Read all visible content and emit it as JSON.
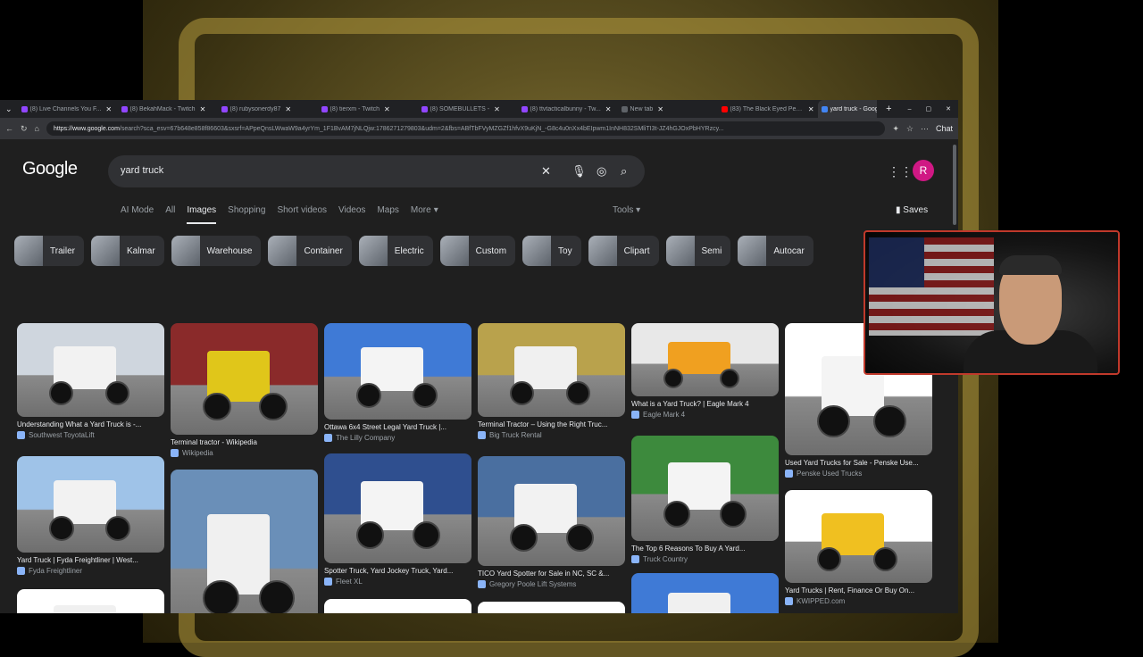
{
  "browser": {
    "tabs": [
      {
        "title": "(8) Live Channels You F...",
        "color": "#9146ff"
      },
      {
        "title": "(8) BekahMack - Twitch",
        "color": "#9146ff"
      },
      {
        "title": "(8) rubysonerdy87",
        "color": "#9146ff"
      },
      {
        "title": "(8) tierxm - Twitch",
        "color": "#9146ff"
      },
      {
        "title": "(8) SOMEBULLETS -",
        "color": "#9146ff"
      },
      {
        "title": "(8) ttvtacticalbunny - Tw...",
        "color": "#9146ff"
      },
      {
        "title": "New tab",
        "color": "#5f6368"
      },
      {
        "title": "(83) The Black Eyed Pea...",
        "color": "#ff0000"
      },
      {
        "title": "yard truck - Google Sea...",
        "color": "#4285f4"
      }
    ],
    "url_domain": "https://www.google.com",
    "url_path": "/search?sca_esv=67b648e858f86603&sxsrf=APpeQnsLWwaW9a4yrYm_1F1BvAM7jNLQjw:1786271279803&udm=2&fbs=ABfTbFVyMZGZf1hfvX9uKjN_-G8c4u0nXx4bEIpwm1InNH832SMliTI3t-JZ4hGJOxPbHYRzcy...",
    "chat_label": "Chat"
  },
  "google": {
    "logo": "Google",
    "query": "yard truck",
    "avatar_letter": "R",
    "nav": [
      "AI Mode",
      "All",
      "Images",
      "Shopping",
      "Short videos",
      "Videos",
      "Maps",
      "More"
    ],
    "nav_selected": "Images",
    "tools": "Tools",
    "saves": "Saves",
    "chips": [
      "Trailer",
      "Kalmar",
      "Warehouse",
      "Container",
      "Electric",
      "Custom",
      "Toy",
      "Clipart",
      "Semi",
      "Autocar"
    ]
  },
  "results": [
    {
      "caption": "Understanding What a Yard Truck is -...",
      "source": "Southwest ToyotaLift",
      "truck": "#f2f2f2",
      "sky": "#cfd6de"
    },
    {
      "caption": "Terminal tractor - Wikipedia",
      "source": "Wikipedia",
      "truck": "#e0c61a",
      "sky": "#8a2a2a"
    },
    {
      "caption": "Ottawa 6x4 Street Legal Yard Truck |...",
      "source": "The Lilly Company",
      "truck": "#f4f4f4",
      "sky": "#3f7ad6"
    },
    {
      "caption": "Terminal Tractor – Using the Right Truc...",
      "source": "Big Truck Rental",
      "truck": "#f0f0f0",
      "sky": "#b9a24c"
    },
    {
      "caption": "What is a Yard Truck? | Eagle Mark 4",
      "source": "Eagle Mark 4",
      "truck": "#f0a020",
      "sky": "#e8e8e8"
    },
    {
      "caption": "Used Yard Trucks for Sale - Penske Use...",
      "source": "Penske Used Trucks",
      "truck": "#f4f4f4",
      "sky": "#ffffff"
    },
    {
      "caption": "Yard Truck | Fyda Freightliner | West...",
      "source": "Fyda Freightliner",
      "truck": "#f2f2f2",
      "sky": "#9fc3e8"
    },
    {
      "caption": "",
      "source": "",
      "truck": "#f0f0f0",
      "sky": "#6a8fb8"
    },
    {
      "caption": "Spotter Truck, Yard Jockey Truck, Yard...",
      "source": "Fleet XL",
      "truck": "#f4f4f4",
      "sky": "#2f4f8f"
    },
    {
      "caption": "TICO Yard Spotter for Sale in NC, SC &...",
      "source": "Gregory Poole Lift Systems",
      "truck": "#f2f2f2",
      "sky": "#4a6fa0"
    },
    {
      "caption": "The Top 6 Reasons To Buy A Yard...",
      "source": "Truck Country",
      "truck": "#f4f4f4",
      "sky": "#3d8a3d"
    },
    {
      "caption": "Yard Trucks | Rent, Finance Or Buy On...",
      "source": "KWIPPED.com",
      "truck": "#f0c020",
      "sky": "#ffffff"
    },
    {
      "caption": "",
      "source": "",
      "truck": "#f0f0f0",
      "sky": "#ffffff"
    },
    {
      "caption": "",
      "source": "",
      "truck": "#f0f0f0",
      "sky": "#ffffff"
    },
    {
      "caption": "",
      "source": "",
      "truck": "#f0f0f0",
      "sky": "#ffffff"
    },
    {
      "caption": "",
      "source": "",
      "truck": "#f0f0f0",
      "sky": "#3f7ad6"
    },
    {
      "caption": "",
      "source": "",
      "truck": "#f0f0f0",
      "sky": "#cfe0f0"
    }
  ]
}
